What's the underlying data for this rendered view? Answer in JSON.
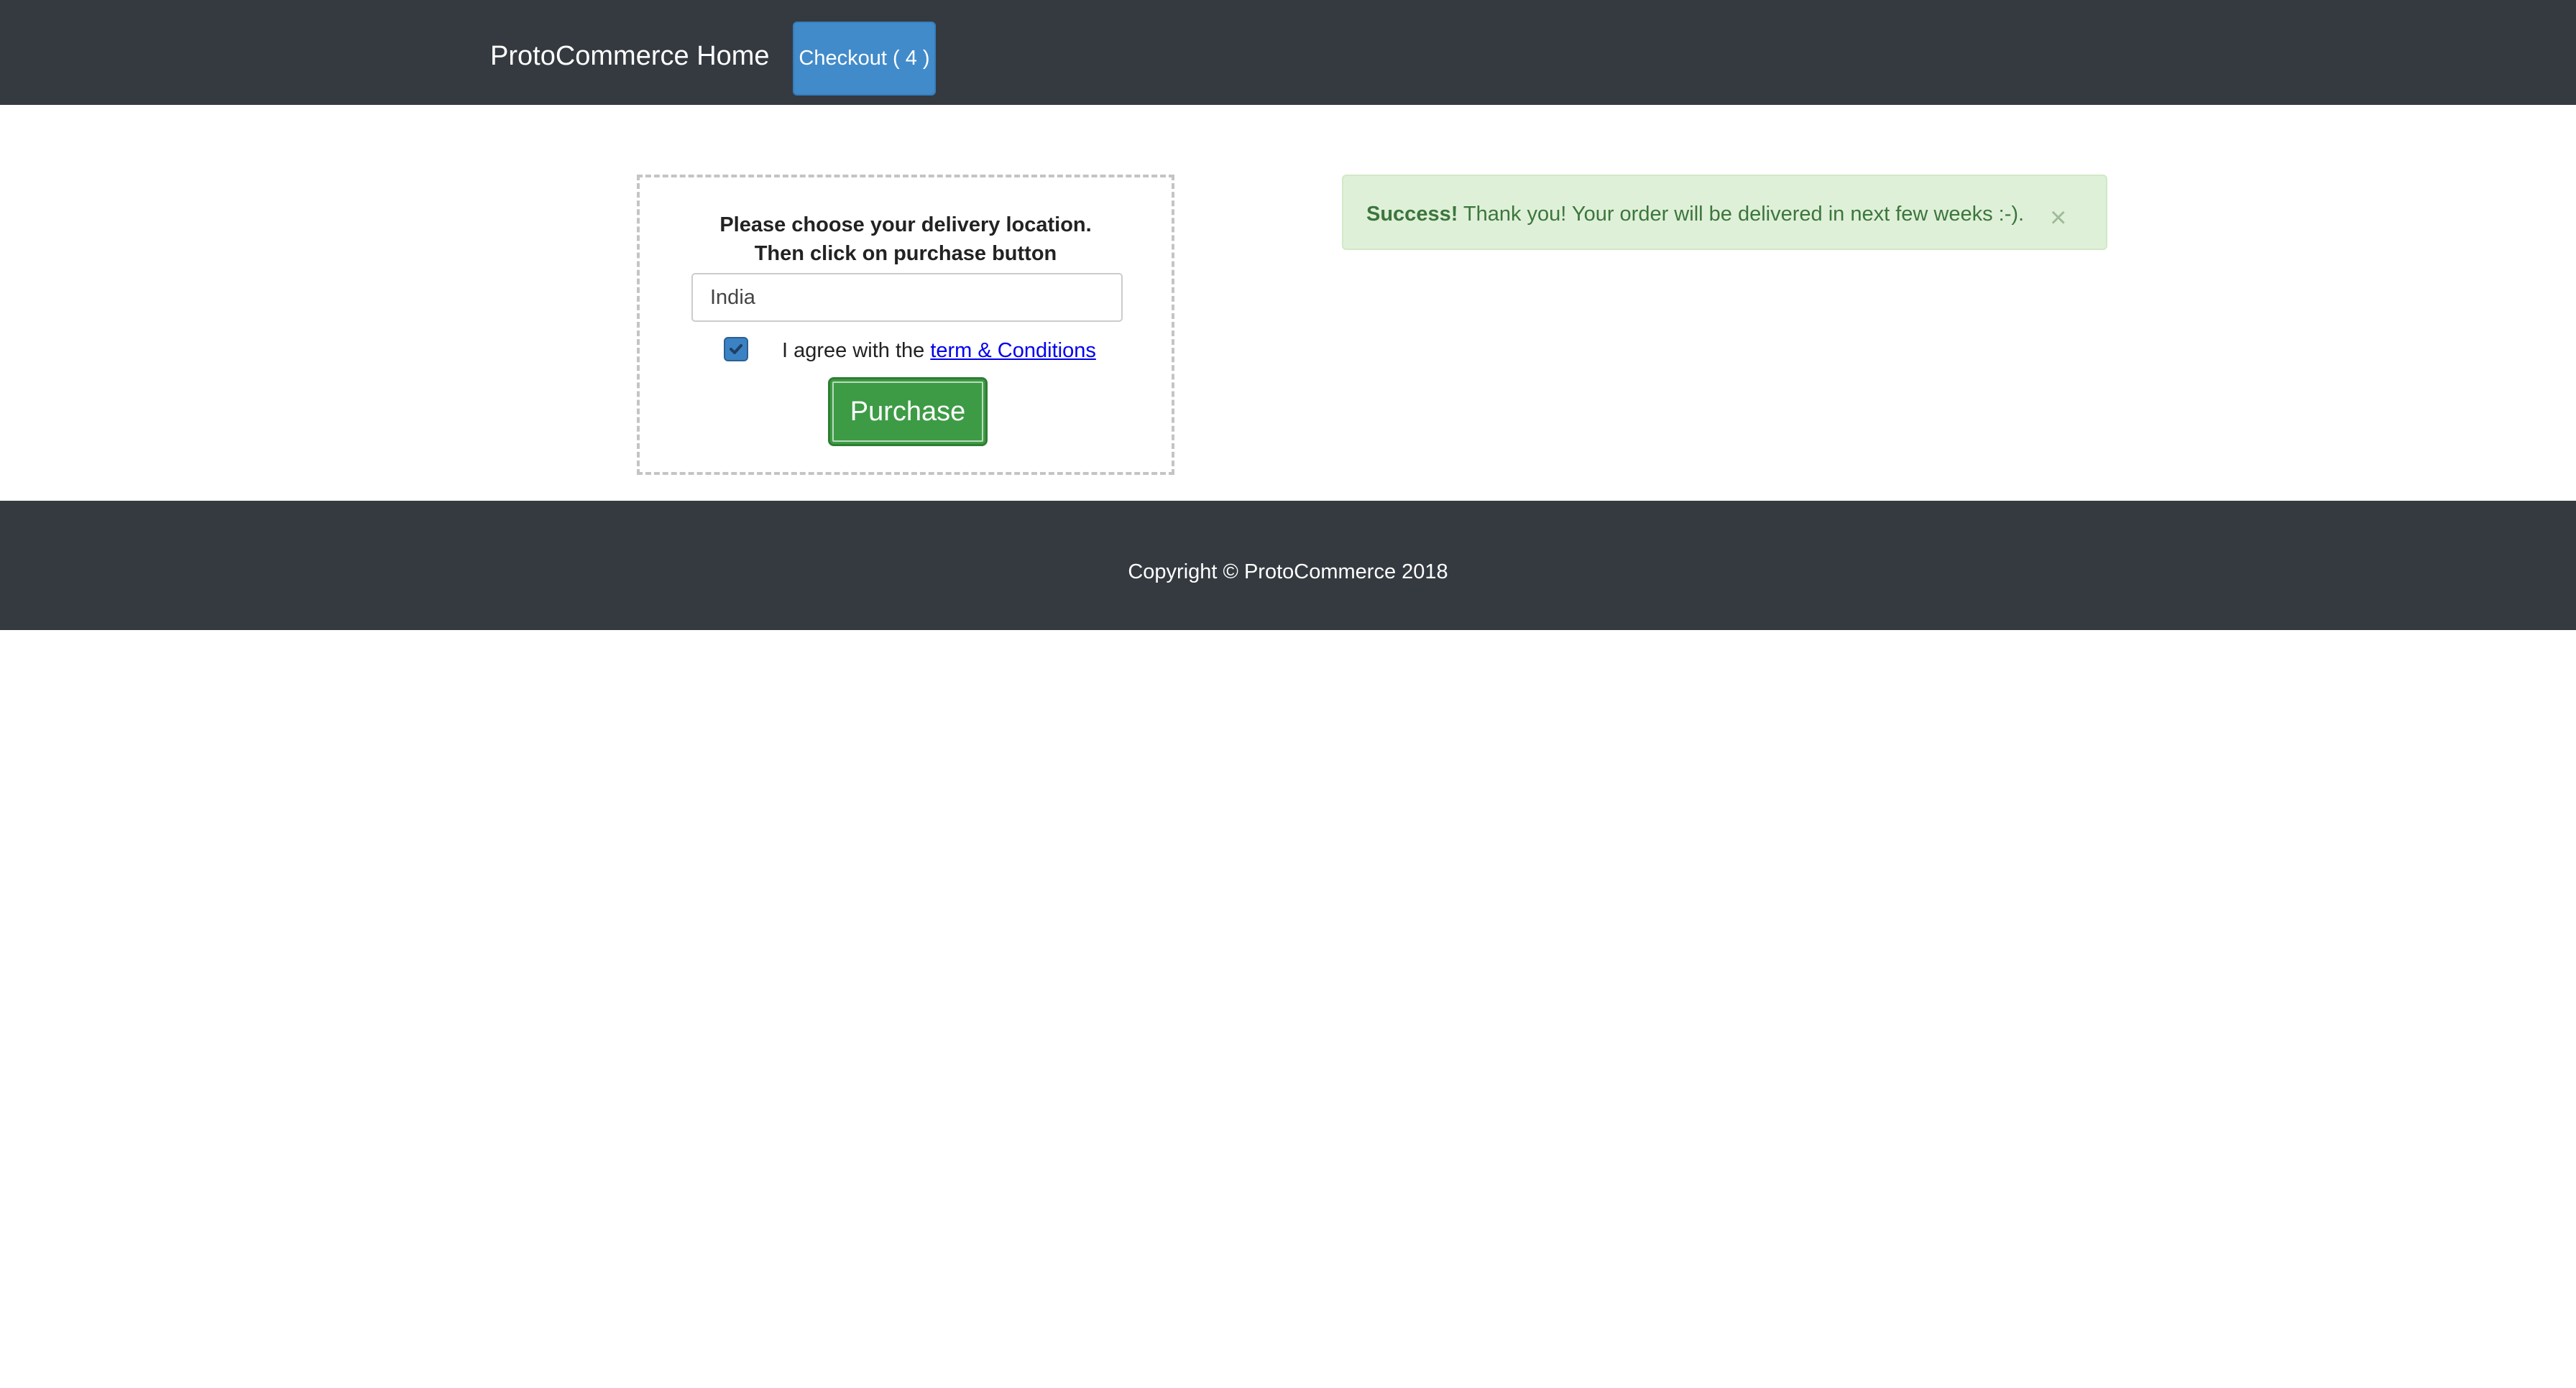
{
  "navbar": {
    "brand": "ProtoCommerce Home",
    "checkout_label": "Checkout ( 4 )"
  },
  "delivery_form": {
    "heading_line1": "Please choose your delivery location.",
    "heading_line2": "Then click on purchase button",
    "location_value": "India",
    "checkbox_checked": true,
    "agree_text": "I agree with the ",
    "terms_link": "term & Conditions",
    "purchase_label": "Purchase"
  },
  "alert": {
    "strong": "Success!",
    "message": " Thank you! Your order will be delivered in next few weeks :-).",
    "close": "×"
  },
  "footer": {
    "copyright": "Copyright © ProtoCommerce 2018"
  },
  "colors": {
    "navbar_bg": "#343a40",
    "checkout_bg": "#428bca",
    "purchase_bg": "#3d9b45",
    "alert_bg": "#dff0d8",
    "alert_text": "#3c763d",
    "link": "#0000ee"
  },
  "icons": {
    "checkbox": "checkmark-icon",
    "alert_close": "close-icon"
  }
}
